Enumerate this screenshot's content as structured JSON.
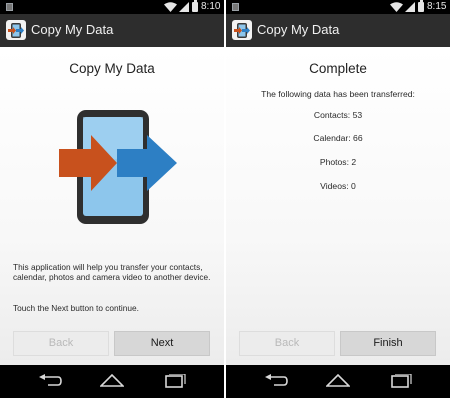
{
  "colors": {
    "status_bar": "#000000",
    "action_bar": "#2d2d2d",
    "nav_bar": "#000000",
    "orange_arrow": "#c8511d",
    "blue_arrow": "#2d7fc4",
    "phone_screen": "#8dc6ec"
  },
  "left": {
    "status": {
      "time": "8:10"
    },
    "app_title": "Copy My Data",
    "screen_title": "Copy My Data",
    "description": "This application will help you transfer your contacts, calendar, photos and camera video to another device.",
    "instruction": "Touch the Next button to continue.",
    "back_label": "Back",
    "next_label": "Next",
    "nav": {
      "back_icon": "back-icon",
      "home_icon": "home-icon",
      "recents_icon": "recents-icon"
    }
  },
  "right": {
    "status": {
      "time": "8:15"
    },
    "app_title": "Copy My Data",
    "screen_title": "Complete",
    "subtitle": "The following data has been transferred:",
    "results": [
      {
        "text": "Contacts: 53"
      },
      {
        "text": "Calendar: 66"
      },
      {
        "text": "Photos: 2"
      },
      {
        "text": "Videos: 0"
      }
    ],
    "back_label": "Back",
    "finish_label": "Finish"
  }
}
